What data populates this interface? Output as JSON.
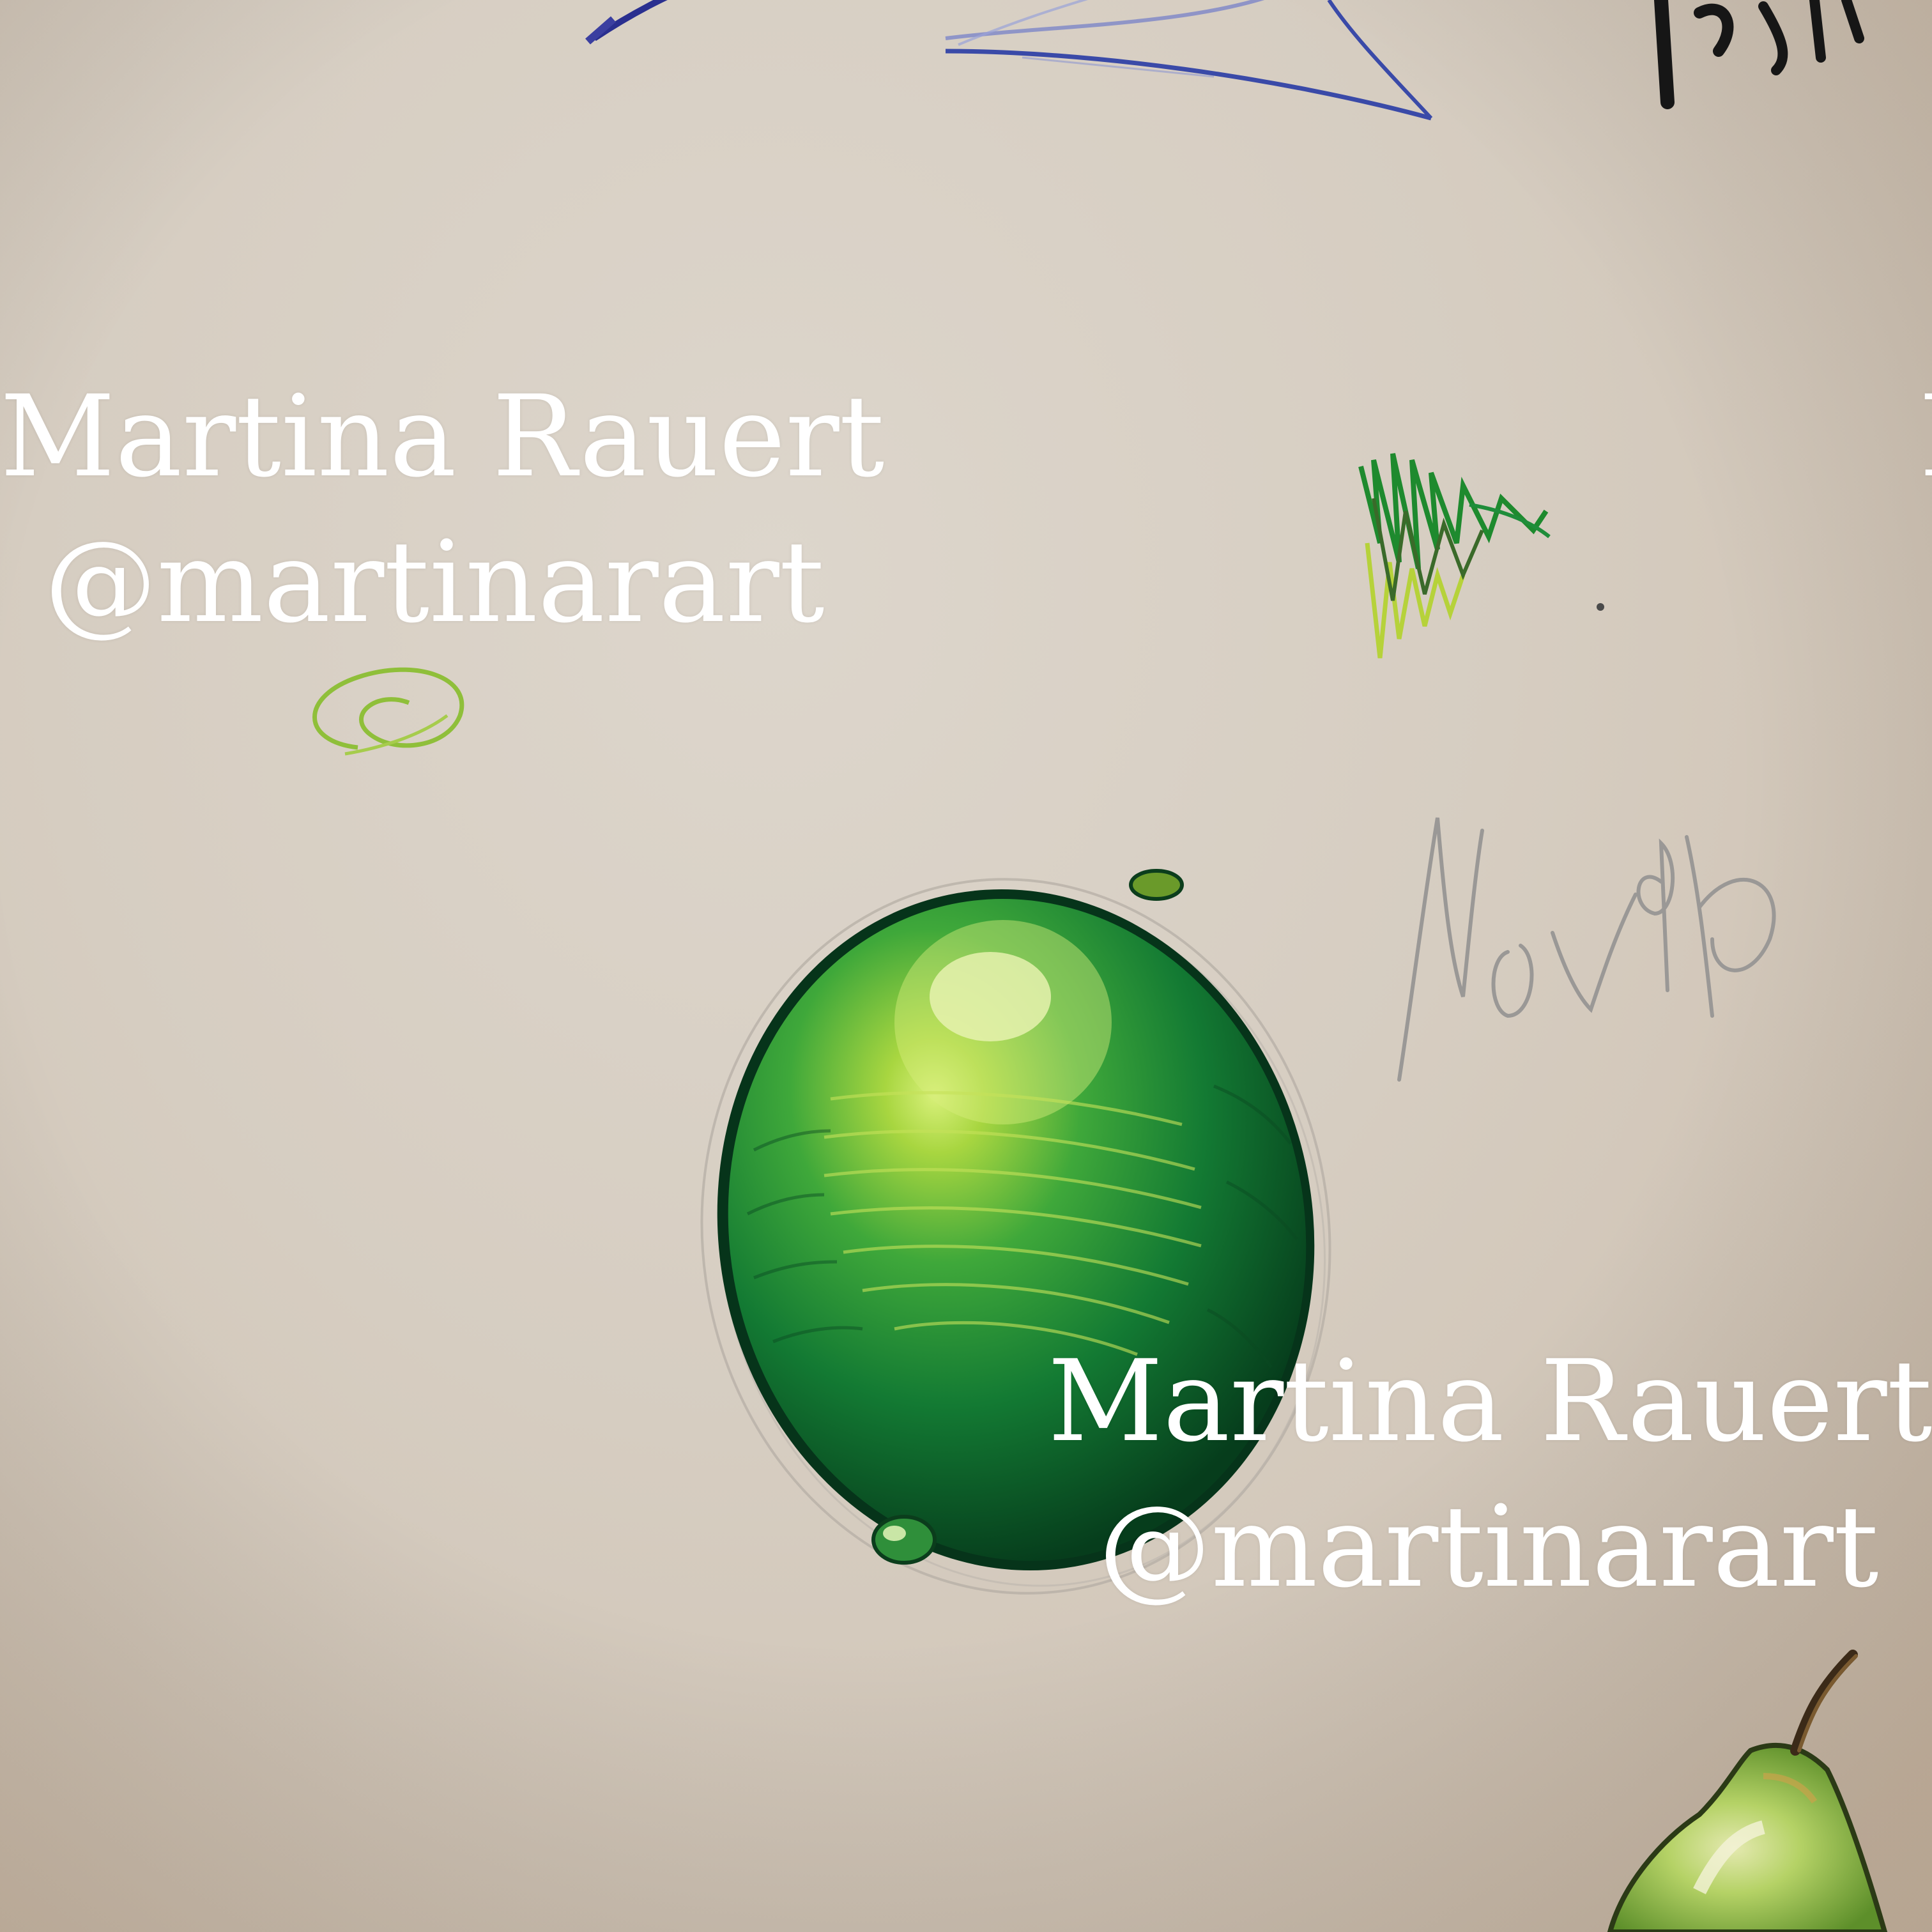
{
  "image": {
    "description_free": true
  },
  "watermarks": [
    {
      "name": "Martina Rauert",
      "handle": "@martinarart"
    },
    {
      "name": "Martina Rauert",
      "handle": "@martinarart"
    },
    {
      "name": "M"
    }
  ],
  "colors": {
    "paper": "#d9cfc3",
    "lime_dark": "#0e5a2a",
    "lime_mid": "#1f8a3a",
    "lime_highlight": "#b8d845",
    "pencil_gray": "#8c8a88",
    "ink_blue": "#3a4aa8",
    "marker_black": "#1a1a1a",
    "pear_green": "#9cc24a"
  },
  "icons": [
    "pencil-sketch",
    "lime-drawing",
    "pear-drawing",
    "leaf-sketch",
    "swatch-scribble",
    "signature-mark"
  ]
}
